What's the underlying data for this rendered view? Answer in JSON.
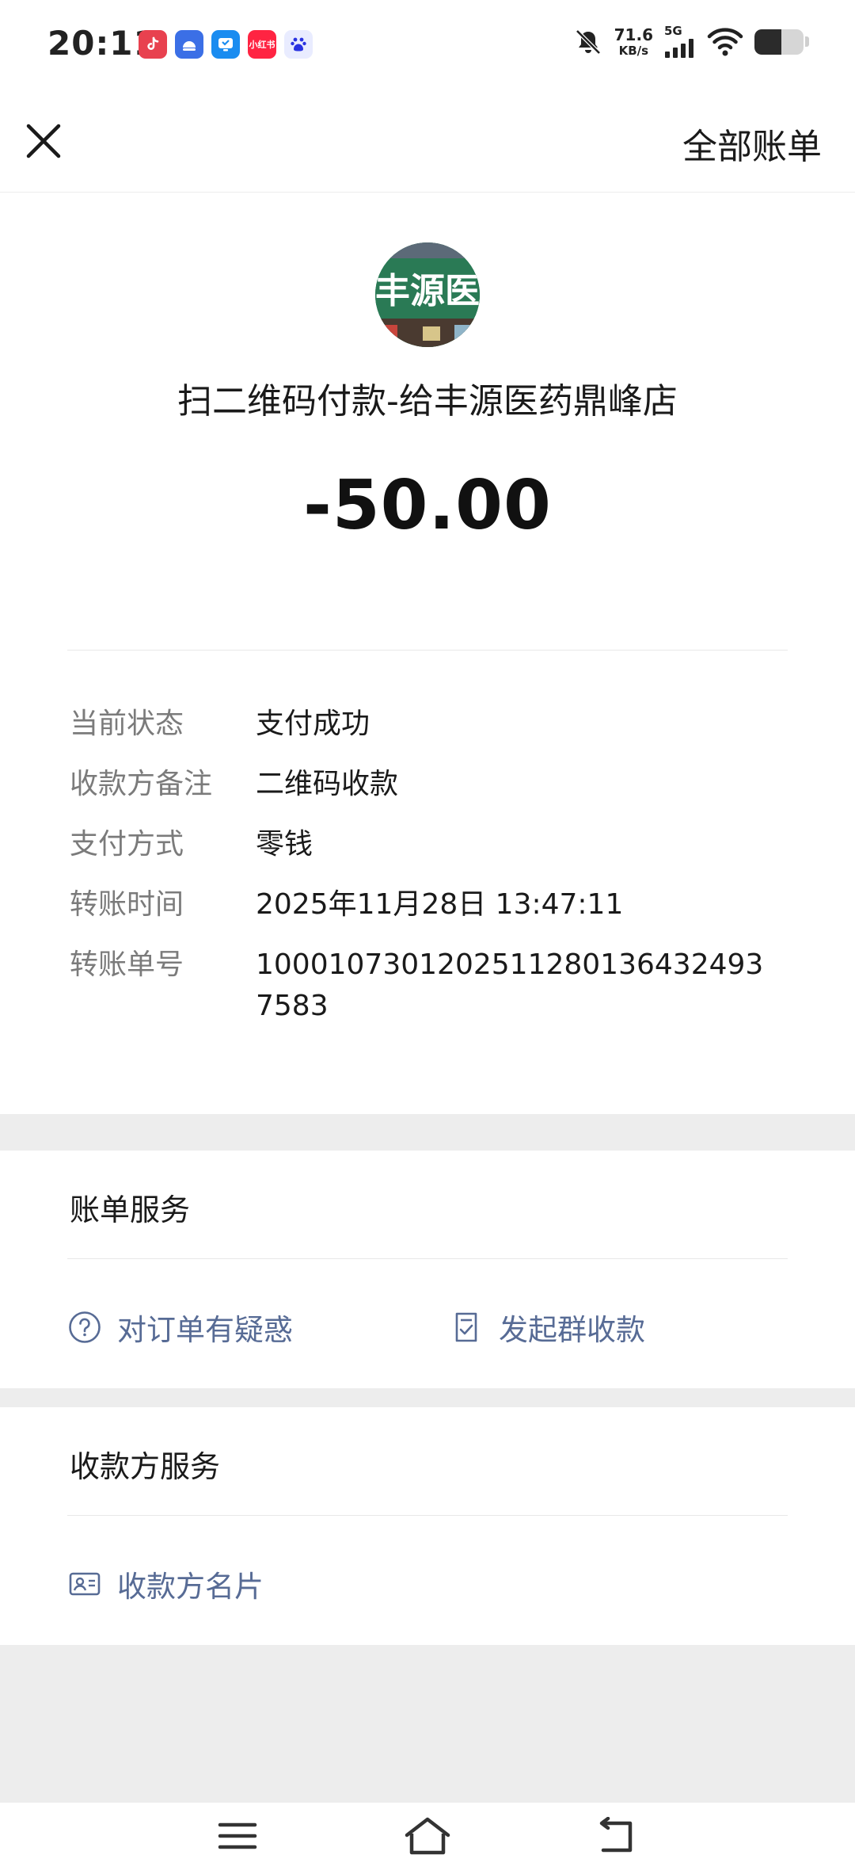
{
  "status_bar": {
    "time": "20:11",
    "app_badges": [
      "douyin-icon",
      "app-icon-2",
      "app-icon-3",
      "xiaohongshu-icon",
      "baidu-icon"
    ],
    "xiaohongshu_label": "小红书",
    "net_speed_value": "71.6",
    "net_speed_unit": "KB/s",
    "network_type": "5G",
    "battery_level": 0.55
  },
  "nav": {
    "all_bills_label": "全部账单"
  },
  "header": {
    "avatar_text": "丰源医",
    "merchant_title": "扫二维码付款-给丰源医药鼎峰店",
    "amount": "-50.00"
  },
  "details": [
    {
      "label": "当前状态",
      "value": "支付成功"
    },
    {
      "label": "收款方备注",
      "value": "二维码收款"
    },
    {
      "label": "支付方式",
      "value": "零钱"
    },
    {
      "label": "转账时间",
      "value": "2025年11月28日 13:47:11"
    },
    {
      "label": "转账单号",
      "value": "10001073012025112801364324937583"
    }
  ],
  "bill_service": {
    "title": "账单服务",
    "question_label": "对订单有疑惑",
    "group_collect_label": "发起群收款"
  },
  "payee_service": {
    "title": "收款方服务",
    "card_label": "收款方名片"
  },
  "colors": {
    "link": "#576b95",
    "label_gray": "#7b7b7b",
    "band_gray": "#ededed"
  }
}
